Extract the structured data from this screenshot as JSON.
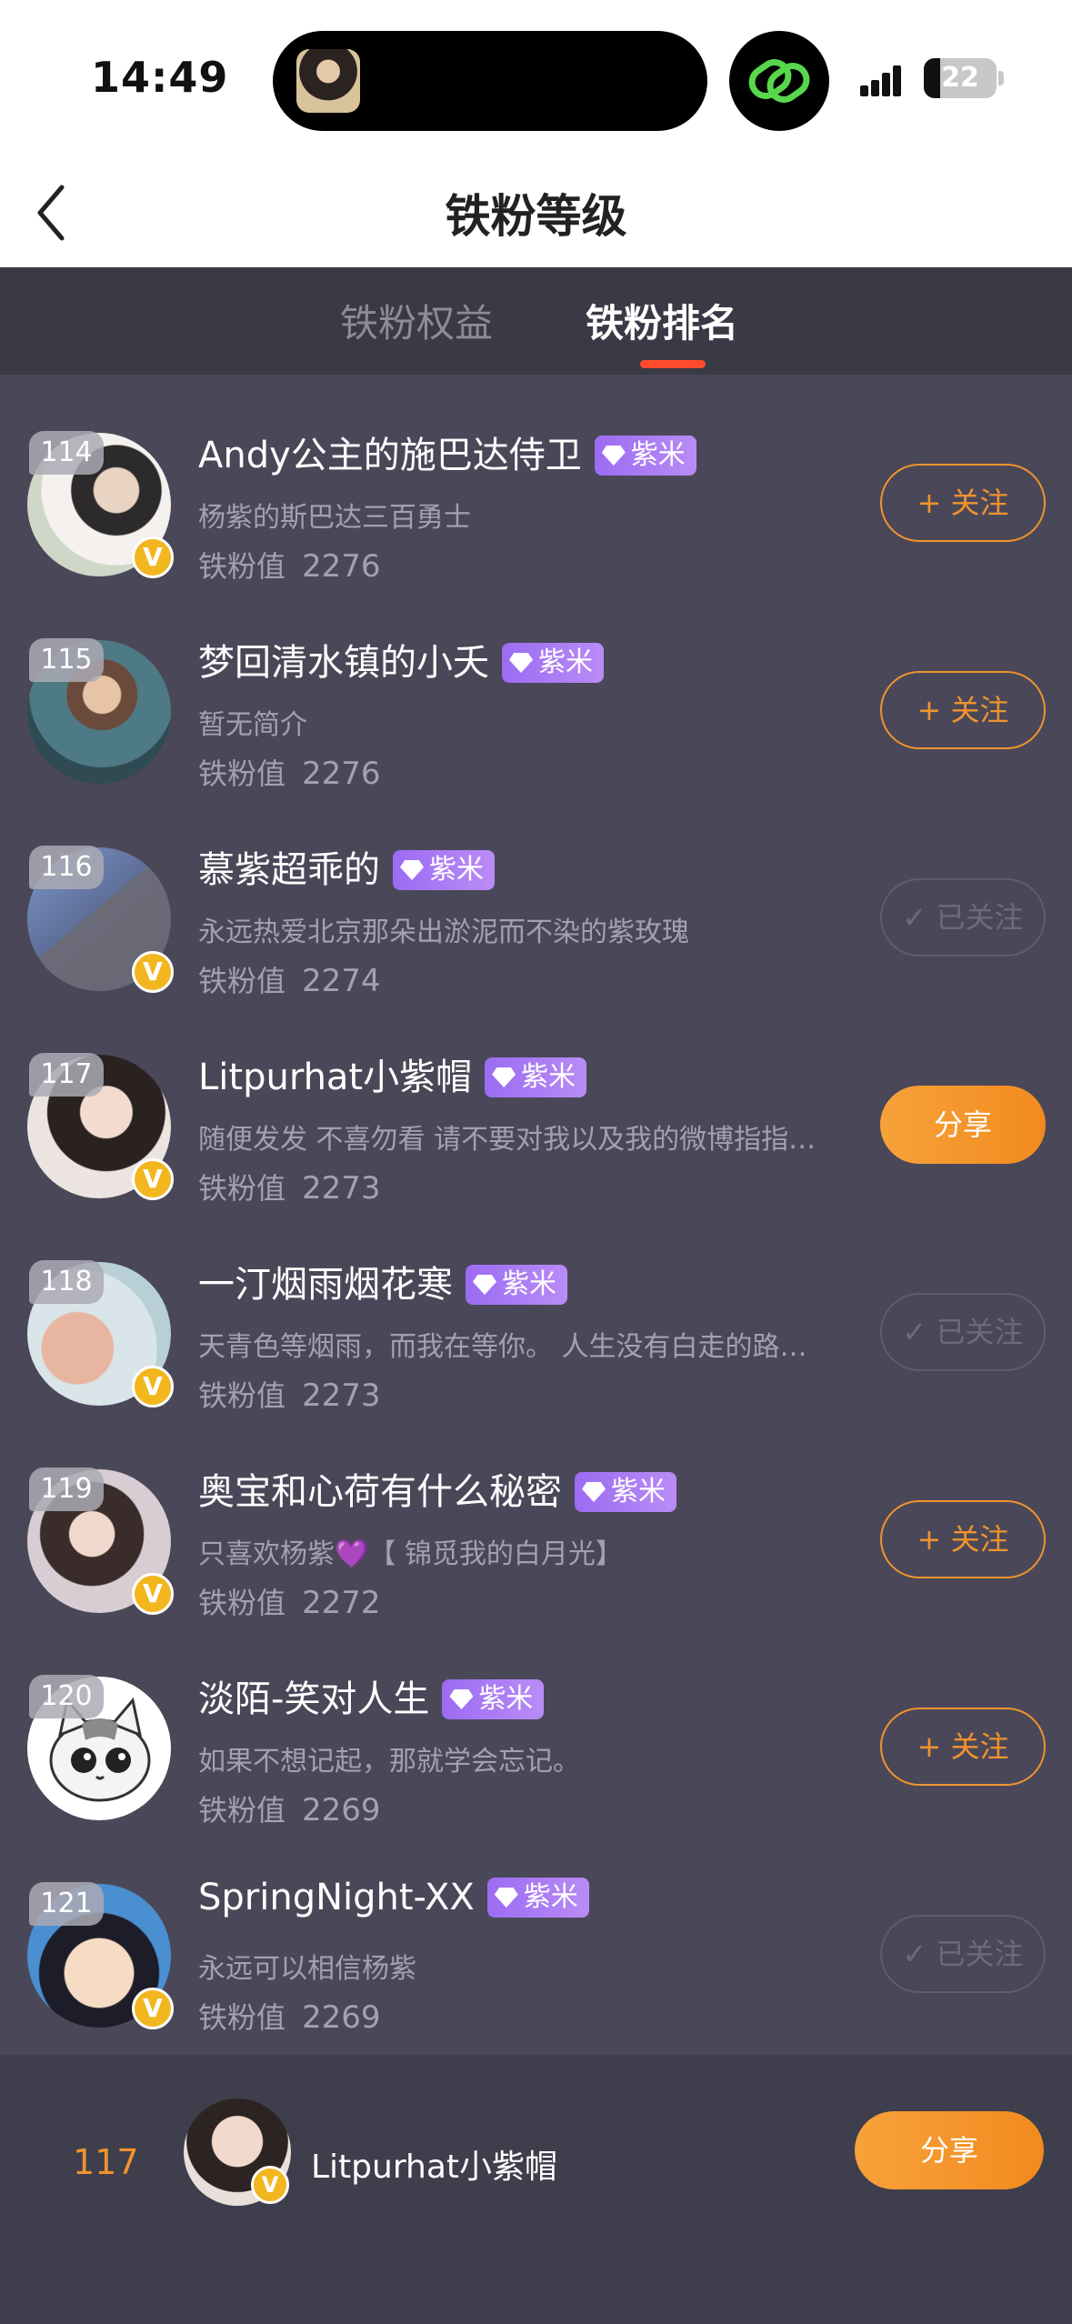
{
  "status_bar": {
    "time": "14:49",
    "battery": "22"
  },
  "nav": {
    "title": "铁粉等级"
  },
  "tabs": [
    {
      "label": "铁粉权益",
      "active": false
    },
    {
      "label": "铁粉排名",
      "active": true
    }
  ],
  "score_label": "铁粉值",
  "tag_label": "紫米",
  "rows": [
    {
      "rank": "114",
      "name": "Andy公主的施巴达侍卫",
      "desc": "杨紫的斯巴达三百勇士",
      "score": "2276",
      "button": "+ 关注",
      "state": "follow"
    },
    {
      "rank": "115",
      "name": "梦回清水镇的小夭",
      "desc": "暂无简介",
      "score": "2276",
      "button": "+ 关注",
      "state": "follow"
    },
    {
      "rank": "116",
      "name": "慕紫超乖的",
      "desc": "永远热爱北京那朵出淤泥而不染的紫玫瑰",
      "score": "2274",
      "button": "✓ 已关注",
      "state": "followed"
    },
    {
      "rank": "117",
      "name": "Litpurhat小紫帽",
      "desc": "随便发发 不喜勿看 请不要对我以及我的微博指指…",
      "score": "2273",
      "button": "分享",
      "state": "share"
    },
    {
      "rank": "118",
      "name": "一汀烟雨烟花寒",
      "desc": "天青色等烟雨，而我在等你。 人生没有白走的路…",
      "score": "2273",
      "button": "✓ 已关注",
      "state": "followed"
    },
    {
      "rank": "119",
      "name": "奥宝和心荷有什么秘密",
      "desc": "只喜欢杨紫💜【 锦觅我的白月光】",
      "score": "2272",
      "button": "+ 关注",
      "state": "follow"
    },
    {
      "rank": "120",
      "name": "淡陌-笑对人生",
      "desc": "如果不想记起，那就学会忘记。",
      "score": "2269",
      "button": "+ 关注",
      "state": "follow"
    },
    {
      "rank": "121",
      "name": "SpringNight-XX",
      "desc": "永远可以相信杨紫",
      "score": "2269",
      "button": "✓ 已关注",
      "state": "followed"
    }
  ],
  "me": {
    "rank": "117",
    "name": "Litpurhat小紫帽",
    "button": "分享"
  },
  "colors": {
    "accent": "#f0932d",
    "tab_underline": "#ff4a2d",
    "tag": "#9b6cf2",
    "vip": "#f2b61e",
    "background": "#4a4858"
  }
}
